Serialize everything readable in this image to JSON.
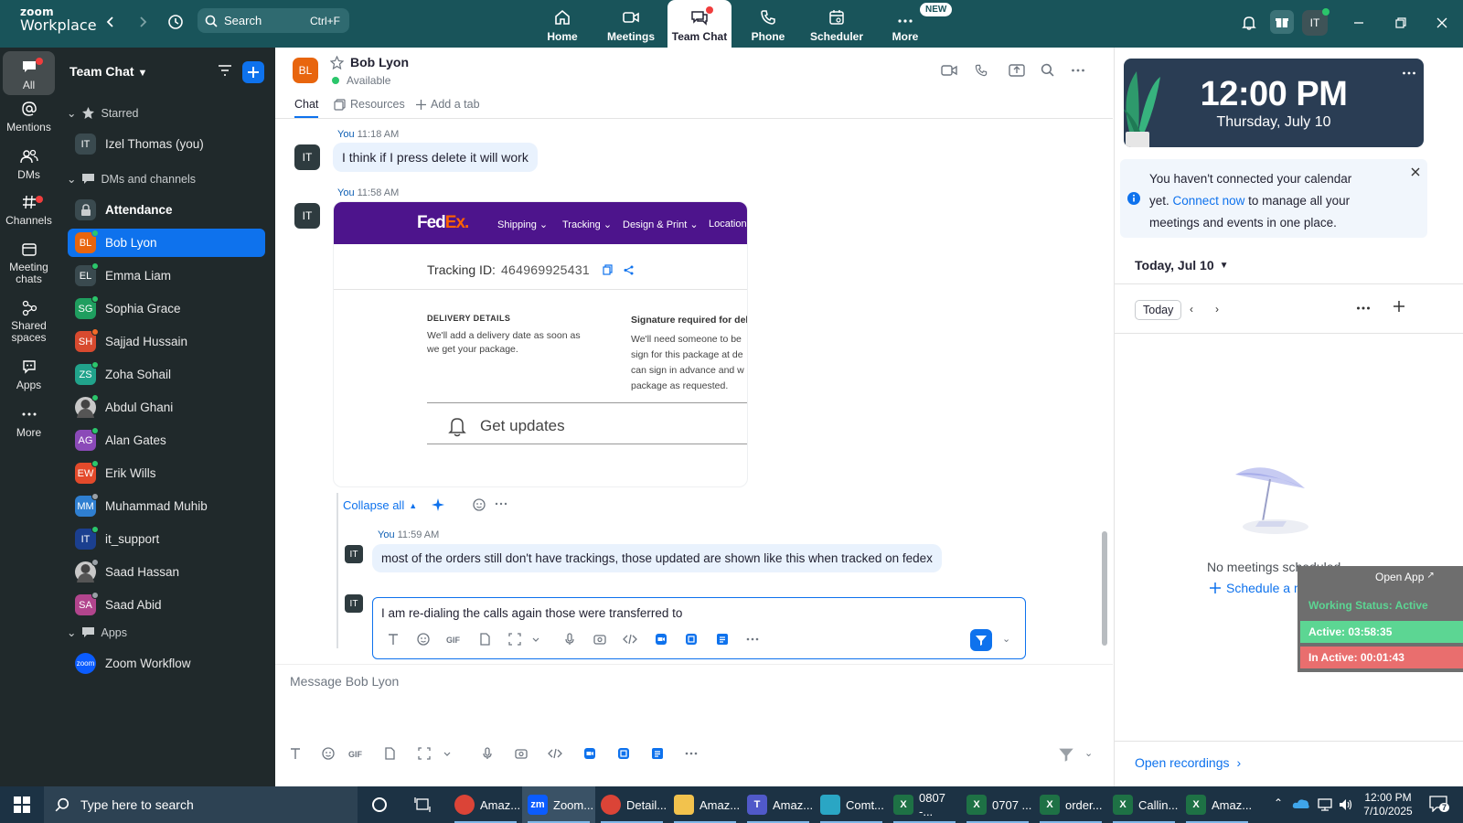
{
  "app": {
    "brand_line1": "zoom",
    "brand_line2": "Workplace"
  },
  "search": {
    "label": "Search",
    "shortcut": "Ctrl+F"
  },
  "top_tabs": [
    {
      "label": "Home",
      "icon": "home-icon"
    },
    {
      "label": "Meetings",
      "icon": "video-icon"
    },
    {
      "label": "Team Chat",
      "icon": "chat-icon",
      "active": true
    },
    {
      "label": "Phone",
      "icon": "phone-icon"
    },
    {
      "label": "Scheduler",
      "icon": "calendar-icon"
    },
    {
      "label": "More",
      "icon": "more-icon",
      "badge": "NEW"
    }
  ],
  "user_initials": "IT",
  "rail": [
    {
      "label": "All",
      "active": true
    },
    {
      "label": "Mentions"
    },
    {
      "label": "DMs"
    },
    {
      "label": "Channels"
    },
    {
      "label": "Meeting chats"
    },
    {
      "label": "Shared spaces"
    },
    {
      "label": "Apps"
    },
    {
      "label": "More"
    }
  ],
  "sidebar": {
    "title": "Team Chat",
    "starred_label": "Starred",
    "dms_label": "DMs and channels",
    "apps_label": "Apps",
    "starred": [
      {
        "initials": "IT",
        "name": "Izel Thomas (you)",
        "color": "#3a4a4f"
      }
    ],
    "items": [
      {
        "initials": "",
        "name": "Attendance",
        "color": "#3a4a4f",
        "bold": true
      },
      {
        "initials": "BL",
        "name": "Bob Lyon",
        "color": "#e8650e",
        "selected": true,
        "status": "#2bc66b"
      },
      {
        "initials": "EL",
        "name": "Emma Liam",
        "color": "#3a4a4f",
        "status": "#2bc66b"
      },
      {
        "initials": "SG",
        "name": "Sophia Grace",
        "color": "#1f9e5f",
        "status": "#2bc66b"
      },
      {
        "initials": "SH",
        "name": "Sajjad Hussain",
        "color": "#d84a2f",
        "status": "#f26a28"
      },
      {
        "initials": "ZS",
        "name": "Zoha Sohail",
        "color": "#21a38b",
        "status": "#2bc66b"
      },
      {
        "initials": "",
        "name": "Abdul Ghani",
        "color": "#c8c8c8",
        "status": "#2bc66b",
        "photo": true
      },
      {
        "initials": "AG",
        "name": "Alan Gates",
        "color": "#8b4ab8",
        "status": "#2bc66b"
      },
      {
        "initials": "EW",
        "name": "Erik Wills",
        "color": "#e34a2b",
        "status": "#2bc66b"
      },
      {
        "initials": "MM",
        "name": "Muhammad Muhib",
        "color": "#2f7fd1",
        "status": "#9aa0a6"
      },
      {
        "initials": "IT",
        "name": "it_support",
        "color": "#1b3f8f",
        "status": "#2bc66b"
      },
      {
        "initials": "",
        "name": "Saad Hassan",
        "color": "#c8c8c8",
        "status": "#9aa0a6",
        "photo": true
      },
      {
        "initials": "SA",
        "name": "Saad Abid",
        "color": "#b2458d",
        "status": "#9aa0a6"
      }
    ],
    "apps": [
      {
        "initials": "zoom",
        "name": "Zoom Workflow",
        "color": "#0b5cff"
      }
    ]
  },
  "chat": {
    "contact_initials": "BL",
    "contact_name": "Bob Lyon",
    "contact_status": "Available",
    "tabs": [
      "Chat",
      "Resources",
      "Add a tab"
    ],
    "messages": [
      {
        "sender": "You",
        "time": "11:18 AM",
        "text": "I think if I press delete it will work",
        "avatar": "IT"
      },
      {
        "sender": "You",
        "time": "11:58 AM",
        "avatar": "IT"
      },
      {
        "sender": "You",
        "time": "11:59 AM",
        "text": "most of the orders still don't have trackings, those updated are shown like this when tracked on fedex",
        "avatar": "IT"
      }
    ],
    "collapse_label": "Collapse all",
    "edit_text": "I am re-dialing the calls again those were transferred to",
    "composer_placeholder": "Message Bob Lyon"
  },
  "fedex": {
    "logo_fed": "Fed",
    "logo_ex": "Ex",
    "logo_dot": ".",
    "nav": [
      "Shipping",
      "Tracking",
      "Design & Print",
      "Locations"
    ],
    "tracking_label": "Tracking ID:",
    "tracking_id": "464969925431",
    "delivery_heading": "DELIVERY DETAILS",
    "delivery_text_1": "We'll add a delivery date as soon as",
    "delivery_text_2": "we get your package.",
    "sig_heading": "Signature required for deli",
    "sig_text_1": "We'll need someone to be",
    "sig_text_2": "sign for this package at de",
    "sig_text_3": "can sign in advance and w",
    "sig_text_4": "package as requested.",
    "get_updates": "Get updates"
  },
  "right_panel": {
    "time": "12:00 PM",
    "date": "Thursday, July 10",
    "notice_1": "You haven't connected your calendar",
    "notice_2": "yet.",
    "notice_link": "Connect now",
    "notice_3": "to manage all your",
    "notice_4": "meetings and events in one place.",
    "day_label": "Today, Jul 10",
    "today_btn": "Today",
    "empty_text": "No meetings scheduled.",
    "schedule_link": "Schedule a meeting",
    "open_recordings": "Open recordings"
  },
  "widget": {
    "open_app": "Open App",
    "working_status": "Working Status: Active",
    "active": "Active: 03:58:35",
    "inactive": "In Active: 00:01:43",
    "colors": {
      "status": "#5cd693",
      "active": "#5cd693",
      "inactive": "#e96e6e"
    }
  },
  "taskbar": {
    "search_placeholder": "Type here to search",
    "apps": [
      {
        "label": "Amaz...",
        "icon": "chrome-icon",
        "color": "#db4437"
      },
      {
        "label": "Zoom...",
        "icon": "zoom-icon",
        "color": "#0b5cff",
        "active": true
      },
      {
        "label": "Detail...",
        "icon": "chrome-icon",
        "color": "#db4437"
      },
      {
        "label": "Amaz...",
        "icon": "folder-icon",
        "color": "#f2c24d"
      },
      {
        "label": "Amaz...",
        "icon": "teams-icon",
        "color": "#5059c9"
      },
      {
        "label": "Comt...",
        "icon": "app-icon",
        "color": "#2aa6c4"
      },
      {
        "label": "0807 -...",
        "icon": "excel-icon",
        "color": "#1e7145"
      },
      {
        "label": "0707 ...",
        "icon": "excel-icon",
        "color": "#1e7145"
      },
      {
        "label": "order...",
        "icon": "excel-icon",
        "color": "#1e7145"
      },
      {
        "label": "Callin...",
        "icon": "excel-icon",
        "color": "#1e7145"
      },
      {
        "label": "Amaz...",
        "icon": "excel-icon",
        "color": "#1e7145"
      }
    ],
    "time": "12:00 PM",
    "date": "7/10/2025",
    "notif_count": "7"
  }
}
